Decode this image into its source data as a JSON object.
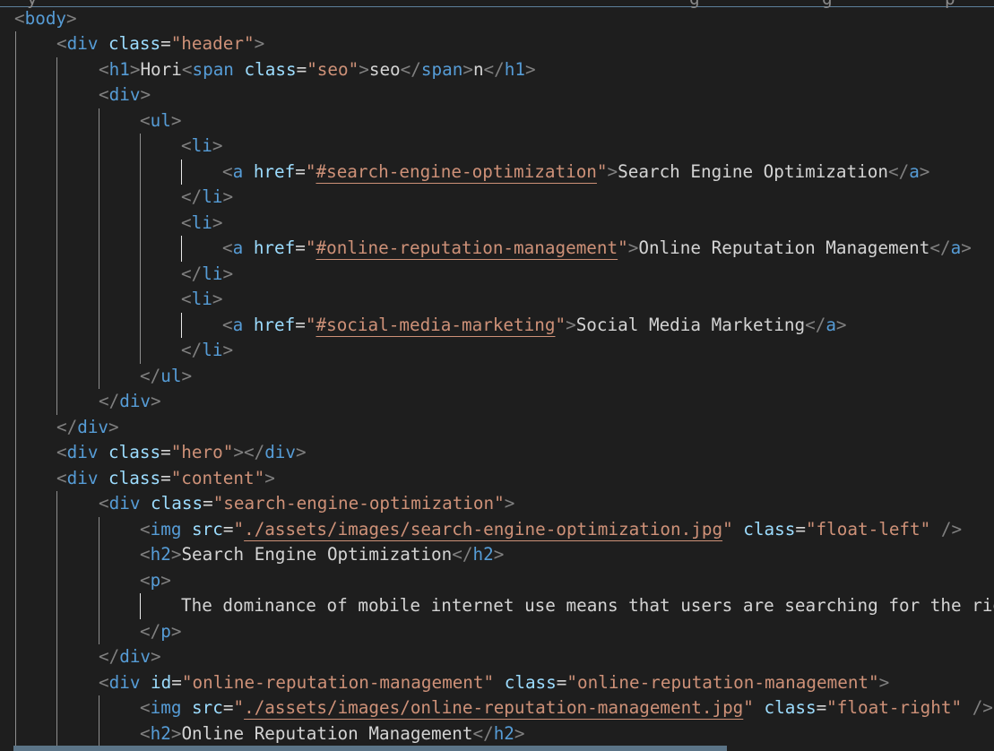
{
  "editor": {
    "language": "html",
    "top_fragments": [
      "y",
      "g",
      "g",
      "p"
    ],
    "lines": [
      [
        {
          "c": "p",
          "s": "<"
        },
        {
          "c": "t",
          "s": "body"
        },
        {
          "c": "p",
          "s": ">"
        }
      ],
      [
        {
          "c": "p",
          "s": "<"
        },
        {
          "c": "t",
          "s": "div"
        },
        {
          "c": "x",
          "s": " "
        },
        {
          "c": "a",
          "s": "class"
        },
        {
          "c": "x",
          "s": "="
        },
        {
          "c": "v",
          "s": "\"header\""
        },
        {
          "c": "p",
          "s": ">"
        }
      ],
      [
        {
          "c": "p",
          "s": "<"
        },
        {
          "c": "t",
          "s": "h1"
        },
        {
          "c": "p",
          "s": ">"
        },
        {
          "c": "x",
          "s": "Hori"
        },
        {
          "c": "p",
          "s": "<"
        },
        {
          "c": "t",
          "s": "span"
        },
        {
          "c": "x",
          "s": " "
        },
        {
          "c": "a",
          "s": "class"
        },
        {
          "c": "x",
          "s": "="
        },
        {
          "c": "v",
          "s": "\"seo\""
        },
        {
          "c": "p",
          "s": ">"
        },
        {
          "c": "x",
          "s": "seo"
        },
        {
          "c": "p",
          "s": "</"
        },
        {
          "c": "t",
          "s": "span"
        },
        {
          "c": "p",
          "s": ">"
        },
        {
          "c": "x",
          "s": "n"
        },
        {
          "c": "p",
          "s": "</"
        },
        {
          "c": "t",
          "s": "h1"
        },
        {
          "c": "p",
          "s": ">"
        }
      ],
      [
        {
          "c": "p",
          "s": "<"
        },
        {
          "c": "t",
          "s": "div"
        },
        {
          "c": "p",
          "s": ">"
        }
      ],
      [
        {
          "c": "p",
          "s": "<"
        },
        {
          "c": "t",
          "s": "ul"
        },
        {
          "c": "p",
          "s": ">"
        }
      ],
      [
        {
          "c": "p",
          "s": "<"
        },
        {
          "c": "t",
          "s": "li"
        },
        {
          "c": "p",
          "s": ">"
        }
      ],
      [
        {
          "c": "p",
          "s": "<"
        },
        {
          "c": "t",
          "s": "a"
        },
        {
          "c": "x",
          "s": " "
        },
        {
          "c": "a",
          "s": "href"
        },
        {
          "c": "x",
          "s": "="
        },
        {
          "c": "v",
          "s": "\""
        },
        {
          "c": "v link",
          "s": "#search-engine-optimization"
        },
        {
          "c": "v",
          "s": "\""
        },
        {
          "c": "p",
          "s": ">"
        },
        {
          "c": "x",
          "s": "Search Engine Optimization"
        },
        {
          "c": "p",
          "s": "</"
        },
        {
          "c": "t",
          "s": "a"
        },
        {
          "c": "p",
          "s": ">"
        }
      ],
      [
        {
          "c": "p",
          "s": "</"
        },
        {
          "c": "t",
          "s": "li"
        },
        {
          "c": "p",
          "s": ">"
        }
      ],
      [
        {
          "c": "p",
          "s": "<"
        },
        {
          "c": "t",
          "s": "li"
        },
        {
          "c": "p",
          "s": ">"
        }
      ],
      [
        {
          "c": "p",
          "s": "<"
        },
        {
          "c": "t",
          "s": "a"
        },
        {
          "c": "x",
          "s": " "
        },
        {
          "c": "a",
          "s": "href"
        },
        {
          "c": "x",
          "s": "="
        },
        {
          "c": "v",
          "s": "\""
        },
        {
          "c": "v link",
          "s": "#online-reputation-management"
        },
        {
          "c": "v",
          "s": "\""
        },
        {
          "c": "p",
          "s": ">"
        },
        {
          "c": "x",
          "s": "Online Reputation Management"
        },
        {
          "c": "p",
          "s": "</"
        },
        {
          "c": "t",
          "s": "a"
        },
        {
          "c": "p",
          "s": ">"
        }
      ],
      [
        {
          "c": "p",
          "s": "</"
        },
        {
          "c": "t",
          "s": "li"
        },
        {
          "c": "p",
          "s": ">"
        }
      ],
      [
        {
          "c": "p",
          "s": "<"
        },
        {
          "c": "t",
          "s": "li"
        },
        {
          "c": "p",
          "s": ">"
        }
      ],
      [
        {
          "c": "p",
          "s": "<"
        },
        {
          "c": "t",
          "s": "a"
        },
        {
          "c": "x",
          "s": " "
        },
        {
          "c": "a",
          "s": "href"
        },
        {
          "c": "x",
          "s": "="
        },
        {
          "c": "v",
          "s": "\""
        },
        {
          "c": "v link",
          "s": "#social-media-marketing"
        },
        {
          "c": "v",
          "s": "\""
        },
        {
          "c": "p",
          "s": ">"
        },
        {
          "c": "x",
          "s": "Social Media Marketing"
        },
        {
          "c": "p",
          "s": "</"
        },
        {
          "c": "t",
          "s": "a"
        },
        {
          "c": "p",
          "s": ">"
        }
      ],
      [
        {
          "c": "p",
          "s": "</"
        },
        {
          "c": "t",
          "s": "li"
        },
        {
          "c": "p",
          "s": ">"
        }
      ],
      [
        {
          "c": "p",
          "s": "</"
        },
        {
          "c": "t",
          "s": "ul"
        },
        {
          "c": "p",
          "s": ">"
        }
      ],
      [
        {
          "c": "p",
          "s": "</"
        },
        {
          "c": "t",
          "s": "div"
        },
        {
          "c": "p",
          "s": ">"
        }
      ],
      [
        {
          "c": "p",
          "s": "</"
        },
        {
          "c": "t",
          "s": "div"
        },
        {
          "c": "p",
          "s": ">"
        }
      ],
      [
        {
          "c": "p",
          "s": "<"
        },
        {
          "c": "t",
          "s": "div"
        },
        {
          "c": "x",
          "s": " "
        },
        {
          "c": "a",
          "s": "class"
        },
        {
          "c": "x",
          "s": "="
        },
        {
          "c": "v",
          "s": "\"hero\""
        },
        {
          "c": "p",
          "s": "></"
        },
        {
          "c": "t",
          "s": "div"
        },
        {
          "c": "p",
          "s": ">"
        }
      ],
      [
        {
          "c": "p",
          "s": "<"
        },
        {
          "c": "t",
          "s": "div"
        },
        {
          "c": "x",
          "s": " "
        },
        {
          "c": "a",
          "s": "class"
        },
        {
          "c": "x",
          "s": "="
        },
        {
          "c": "v",
          "s": "\"content\""
        },
        {
          "c": "p",
          "s": ">"
        }
      ],
      [
        {
          "c": "p",
          "s": "<"
        },
        {
          "c": "t",
          "s": "div"
        },
        {
          "c": "x",
          "s": " "
        },
        {
          "c": "a",
          "s": "class"
        },
        {
          "c": "x",
          "s": "="
        },
        {
          "c": "v",
          "s": "\"search-engine-optimization\""
        },
        {
          "c": "p",
          "s": ">"
        }
      ],
      [
        {
          "c": "p",
          "s": "<"
        },
        {
          "c": "t",
          "s": "img"
        },
        {
          "c": "x",
          "s": " "
        },
        {
          "c": "a",
          "s": "src"
        },
        {
          "c": "x",
          "s": "="
        },
        {
          "c": "v",
          "s": "\""
        },
        {
          "c": "v link",
          "s": "./assets/images/search-engine-optimization.jpg"
        },
        {
          "c": "v",
          "s": "\""
        },
        {
          "c": "x",
          "s": " "
        },
        {
          "c": "a",
          "s": "class"
        },
        {
          "c": "x",
          "s": "="
        },
        {
          "c": "v",
          "s": "\"float-left\""
        },
        {
          "c": "x",
          "s": " "
        },
        {
          "c": "p",
          "s": "/>"
        }
      ],
      [
        {
          "c": "p",
          "s": "<"
        },
        {
          "c": "t",
          "s": "h2"
        },
        {
          "c": "p",
          "s": ">"
        },
        {
          "c": "x",
          "s": "Search Engine Optimization"
        },
        {
          "c": "p",
          "s": "</"
        },
        {
          "c": "t",
          "s": "h2"
        },
        {
          "c": "p",
          "s": ">"
        }
      ],
      [
        {
          "c": "p",
          "s": "<"
        },
        {
          "c": "t",
          "s": "p"
        },
        {
          "c": "p",
          "s": ">"
        }
      ],
      [
        {
          "c": "x",
          "s": "The dominance of mobile internet use means that users are searching for the rig"
        }
      ],
      [
        {
          "c": "p",
          "s": "</"
        },
        {
          "c": "t",
          "s": "p"
        },
        {
          "c": "p",
          "s": ">"
        }
      ],
      [
        {
          "c": "p",
          "s": "</"
        },
        {
          "c": "t",
          "s": "div"
        },
        {
          "c": "p",
          "s": ">"
        }
      ],
      [
        {
          "c": "p",
          "s": "<"
        },
        {
          "c": "t",
          "s": "div"
        },
        {
          "c": "x",
          "s": " "
        },
        {
          "c": "a",
          "s": "id"
        },
        {
          "c": "x",
          "s": "="
        },
        {
          "c": "v",
          "s": "\"online-reputation-management\""
        },
        {
          "c": "x",
          "s": " "
        },
        {
          "c": "a",
          "s": "class"
        },
        {
          "c": "x",
          "s": "="
        },
        {
          "c": "v",
          "s": "\"online-reputation-management\""
        },
        {
          "c": "p",
          "s": ">"
        }
      ],
      [
        {
          "c": "p",
          "s": "<"
        },
        {
          "c": "t",
          "s": "img"
        },
        {
          "c": "x",
          "s": " "
        },
        {
          "c": "a",
          "s": "src"
        },
        {
          "c": "x",
          "s": "="
        },
        {
          "c": "v",
          "s": "\""
        },
        {
          "c": "v link",
          "s": "./assets/images/online-reputation-management.jpg"
        },
        {
          "c": "v",
          "s": "\""
        },
        {
          "c": "x",
          "s": " "
        },
        {
          "c": "a",
          "s": "class"
        },
        {
          "c": "x",
          "s": "="
        },
        {
          "c": "v",
          "s": "\"float-right\""
        },
        {
          "c": "x",
          "s": " "
        },
        {
          "c": "p",
          "s": "/>"
        }
      ],
      [
        {
          "c": "p",
          "s": "<"
        },
        {
          "c": "t",
          "s": "h2"
        },
        {
          "c": "p",
          "s": ">"
        },
        {
          "c": "x",
          "s": "Online Reputation Management"
        },
        {
          "c": "p",
          "s": "</"
        },
        {
          "c": "t",
          "s": "h2"
        },
        {
          "c": "p",
          "s": ">"
        }
      ]
    ]
  }
}
